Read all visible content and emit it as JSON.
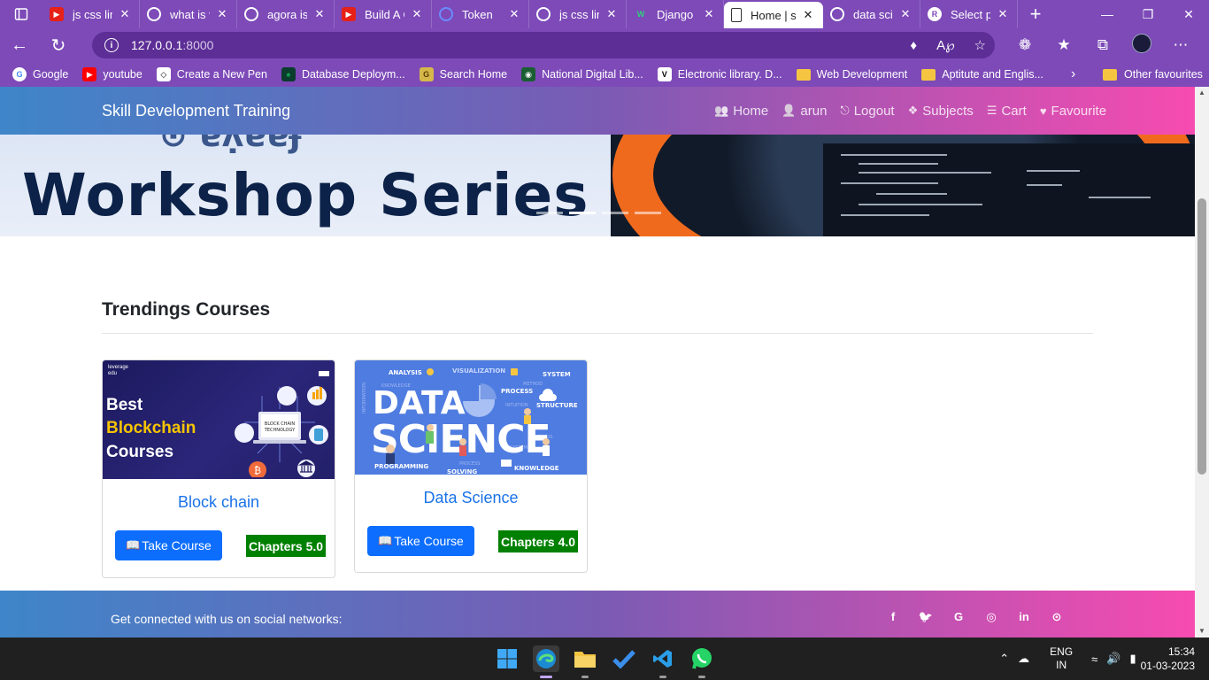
{
  "browser": {
    "tabs": [
      {
        "title": "js css lin",
        "fav": "yt",
        "color": "#e62117"
      },
      {
        "title": "what is v",
        "fav": "G",
        "color": "#8e63c9"
      },
      {
        "title": "agora is",
        "fav": "G",
        "color": "#8e63c9"
      },
      {
        "title": "Build A C",
        "fav": "yt",
        "color": "#e62117"
      },
      {
        "title": "Token",
        "fav": "A",
        "color": "#3b63d8"
      },
      {
        "title": "js css lin",
        "fav": "G",
        "color": "#8e63c9"
      },
      {
        "title": "Django",
        "fav": "W",
        "color": "#1f8a4c"
      },
      {
        "title": "Home | s",
        "fav": "doc",
        "color": "#ffffff",
        "active": true
      },
      {
        "title": "data scie",
        "fav": "G",
        "color": "#ffffff"
      },
      {
        "title": "Select pr",
        "fav": "R",
        "color": "#ffffff"
      }
    ],
    "url_host": "127.0.0.1",
    "url_port": ":8000",
    "bookmarks": [
      {
        "label": "Google",
        "icon": "google-icon",
        "bg": "#ffffff",
        "fg": "#4285f4",
        "glyph": "G"
      },
      {
        "label": "youtube",
        "icon": "youtube-icon",
        "bg": "#ff0000",
        "fg": "#ffffff",
        "glyph": "▶"
      },
      {
        "label": "Create a New Pen",
        "icon": "codepen-icon",
        "bg": "#ffffff",
        "fg": "#000000",
        "glyph": "◇"
      },
      {
        "label": "Database Deploym...",
        "icon": "mongodb-leaf-icon",
        "bg": "#0b3d2e",
        "fg": "#13aa52",
        "glyph": "♠"
      },
      {
        "label": "Search Home",
        "icon": "search-home-icon",
        "bg": "#d6b84a",
        "fg": "#5a3b00",
        "glyph": "G"
      },
      {
        "label": "National Digital Lib...",
        "icon": "ndl-icon",
        "bg": "#1a5e32",
        "fg": "#ffffff",
        "glyph": "◉"
      },
      {
        "label": "Electronic library. D...",
        "icon": "vlib-icon",
        "bg": "#ffffff",
        "fg": "#000000",
        "glyph": "V"
      },
      {
        "label": "Web Development",
        "icon": "folder-icon",
        "bg": "#f5c542",
        "fg": "#f5c542",
        "glyph": ""
      },
      {
        "label": "Aptitute and Englis...",
        "icon": "folder-icon",
        "bg": "#f5c542",
        "fg": "#f5c542",
        "glyph": ""
      }
    ],
    "other_favourites": "Other favourites"
  },
  "site": {
    "brand": "Skill Development Training",
    "nav": [
      {
        "label": "Home",
        "icon": "home-users-icon",
        "glyph": "👥"
      },
      {
        "label": "arun",
        "icon": "user-icon",
        "glyph": "👤"
      },
      {
        "label": "Logout",
        "icon": "logout-icon",
        "glyph": "⎋"
      },
      {
        "label": "Subjects",
        "icon": "cubes-icon",
        "glyph": "❖"
      },
      {
        "label": "Cart",
        "icon": "list-icon",
        "glyph": "☰"
      },
      {
        "label": "Favourite",
        "icon": "heart-icon",
        "glyph": "♥"
      }
    ],
    "hero": {
      "title": "Workshop Series"
    },
    "section_title": "Trendings Courses",
    "courses": [
      {
        "title": "Block chain",
        "button": "Take Course",
        "chapters": "Chapters 5.0",
        "image": {
          "line1": "Best",
          "line2": "Blockchain",
          "line3": "Courses",
          "badge": "leverage edu",
          "laptop": "BLOCK CHAIN TECHNOLOGY"
        }
      },
      {
        "title": "Data Science",
        "button": "Take Course",
        "chapters": "Chapters 4.0",
        "image": {
          "word1": "DATA",
          "word2": "SCIENCE",
          "tags": [
            "ANALYSIS",
            "VISUALIZATION",
            "SYSTEM",
            "PROCESS",
            "STRUCTURE",
            "PROGRAMMING",
            "SOLVING",
            "KNOWLEDGE"
          ]
        }
      }
    ],
    "footer_text": "Get connected with us on social networks:",
    "social": [
      {
        "icon": "facebook-icon",
        "glyph": "f"
      },
      {
        "icon": "twitter-icon",
        "glyph": "🐦"
      },
      {
        "icon": "google-icon",
        "glyph": "G"
      },
      {
        "icon": "instagram-icon",
        "glyph": "◎"
      },
      {
        "icon": "linkedin-icon",
        "glyph": "in"
      },
      {
        "icon": "github-icon",
        "glyph": "⊙"
      }
    ]
  },
  "taskbar": {
    "lang_top": "ENG",
    "lang_bottom": "IN",
    "time": "15:34",
    "date": "01-03-2023"
  }
}
